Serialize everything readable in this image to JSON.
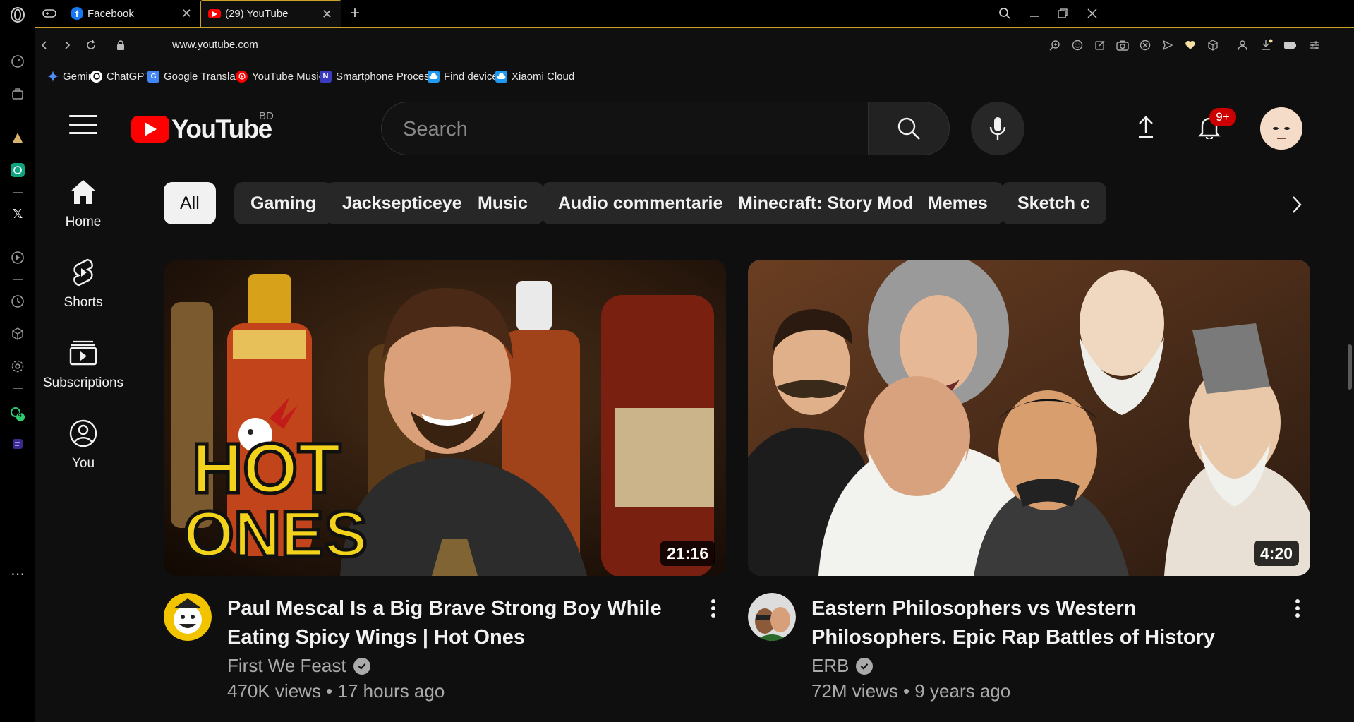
{
  "browser": {
    "tabs": [
      {
        "title": "Facebook",
        "favicon": "facebook-icon",
        "active": false
      },
      {
        "title": "(29) YouTube",
        "favicon": "youtube-icon",
        "active": true
      }
    ],
    "url": "www.youtube.com",
    "bookmarks": [
      {
        "label": "Gemini",
        "icon": "gemini-icon"
      },
      {
        "label": "ChatGPT",
        "icon": "chatgpt-icon"
      },
      {
        "label": "Google Translate",
        "icon": "translate-icon"
      },
      {
        "label": "YouTube Music",
        "icon": "youtube-music-icon"
      },
      {
        "label": "Smartphone Proces...",
        "icon": "nanoreview-icon"
      },
      {
        "label": "Find device",
        "icon": "cloud-icon"
      },
      {
        "label": "Xiaomi Cloud",
        "icon": "cloud-icon"
      }
    ],
    "sidebar_badge": "4"
  },
  "youtube": {
    "logo_text": "YouTube",
    "country_code": "BD",
    "search_placeholder": "Search",
    "notification_count": "9+",
    "guide": [
      {
        "label": "Home",
        "icon": "home-icon"
      },
      {
        "label": "Shorts",
        "icon": "shorts-icon"
      },
      {
        "label": "Subscriptions",
        "icon": "subscriptions-icon"
      },
      {
        "label": "You",
        "icon": "you-icon"
      }
    ],
    "chips": [
      "All",
      "Gaming",
      "Jacksepticeye",
      "Music",
      "Audio commentaries",
      "Minecraft: Story Mode",
      "Memes",
      "Sketch c"
    ],
    "selected_chip": "All",
    "videos": [
      {
        "title": "Paul Mescal Is a Big Brave Strong Boy While Eating Spicy Wings | Hot Ones",
        "channel": "First We Feast",
        "verified": true,
        "views": "470K views",
        "age": "17 hours ago",
        "meta": "470K views • 17 hours ago",
        "duration": "21:16",
        "thumb_text_1": "HOT",
        "thumb_text_2": "ONES",
        "thumb_colors": {
          "bg": "#3a2412",
          "accent": "#f2d21a"
        }
      },
      {
        "title": "Eastern Philosophers vs Western Philosophers. Epic Rap Battles of History",
        "channel": "ERB",
        "verified": true,
        "views": "72M views",
        "age": "9 years ago",
        "meta": "72M views • 9 years ago",
        "duration": "4:20",
        "thumb_colors": {
          "bg": "#5a3a22",
          "accent": "#e8e0d4"
        }
      }
    ]
  },
  "colors": {
    "youtube_red": "#ff0000",
    "badge_red": "#cc0000",
    "tab_accent": "#c9a227",
    "page_bg": "#0f0f0f"
  }
}
